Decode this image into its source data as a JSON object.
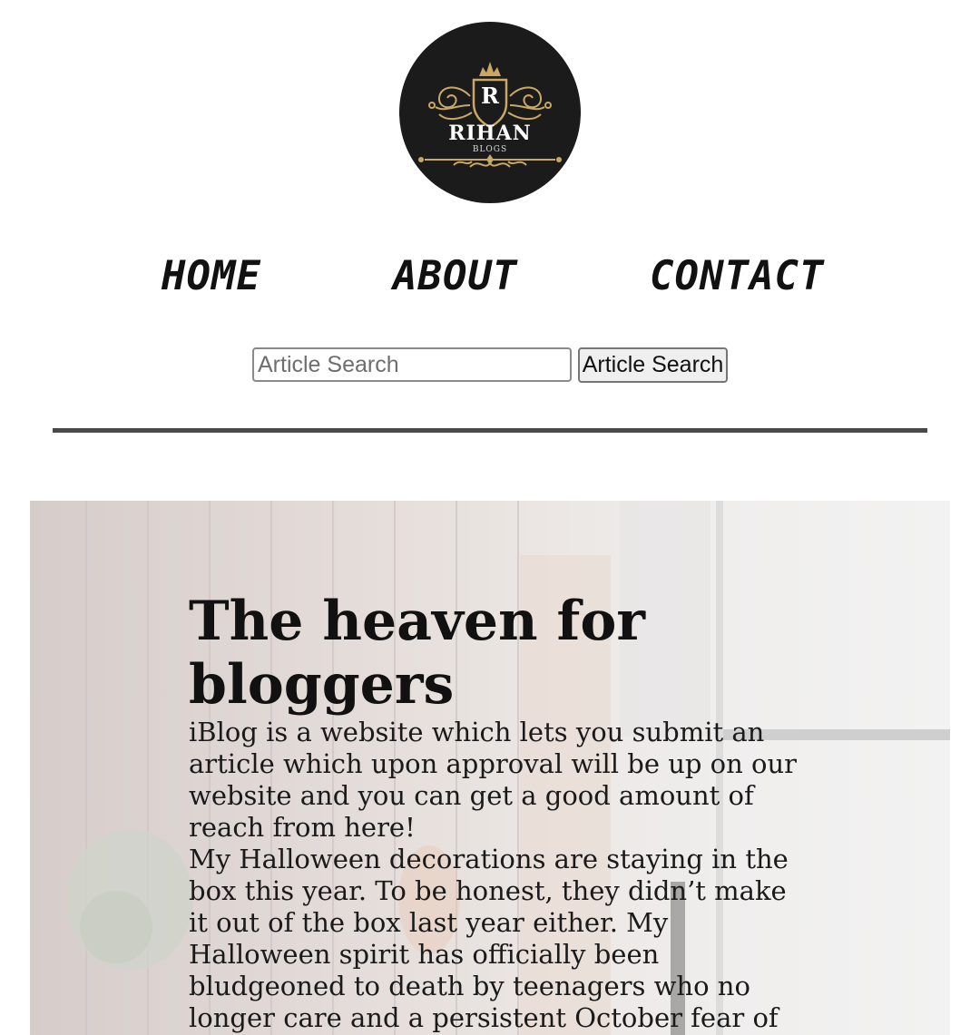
{
  "logo": {
    "letter": "R",
    "name": "RIHAN",
    "tagline": "BLOGS",
    "colors": {
      "background": "#1c1b1b",
      "gold": "#c9a865"
    }
  },
  "nav": {
    "items": [
      {
        "label": "HOME"
      },
      {
        "label": "ABOUT"
      },
      {
        "label": "CONTACT"
      }
    ]
  },
  "search": {
    "placeholder": "Article Search",
    "button_label": "Article Search"
  },
  "hero": {
    "title": "The heaven for bloggers",
    "paragraphs": [
      "iBlog is a website which lets you submit an article which upon approval will be up on our website and you can get a good amount of reach from here!",
      "My Halloween decorations are staying in the box this year. To be honest, they didn’t make it out of the box last year either. My Halloween spirit has officially been bludgeoned to death by teenagers who no longer care and a persistent October fear of"
    ]
  }
}
